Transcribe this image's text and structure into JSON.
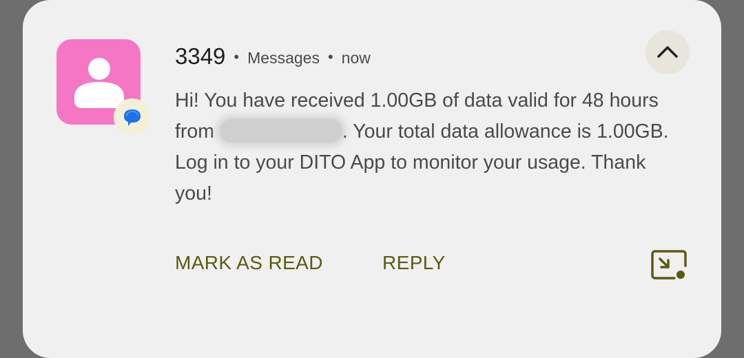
{
  "notification": {
    "sender": "3349",
    "app_name": "Messages",
    "time": "now",
    "separator": "•",
    "message_part1": "Hi! You have received 1.00GB of data valid for 48 hours from ",
    "message_part2": ". Your total data allowance is 1.00GB. Log in to your DITO App to monitor your usage. Thank you!",
    "actions": {
      "mark_as_read": "MARK AS READ",
      "reply": "REPLY"
    },
    "icons": {
      "avatar": "contact-person-icon",
      "app_badge": "messages-bubble-icon",
      "expand": "chevron-up-icon",
      "picture_in_picture": "open-bubble-icon"
    },
    "colors": {
      "avatar_background": "#f676c6",
      "action_text": "#5c5a10",
      "badge_bubble": "#1a73e8"
    }
  }
}
